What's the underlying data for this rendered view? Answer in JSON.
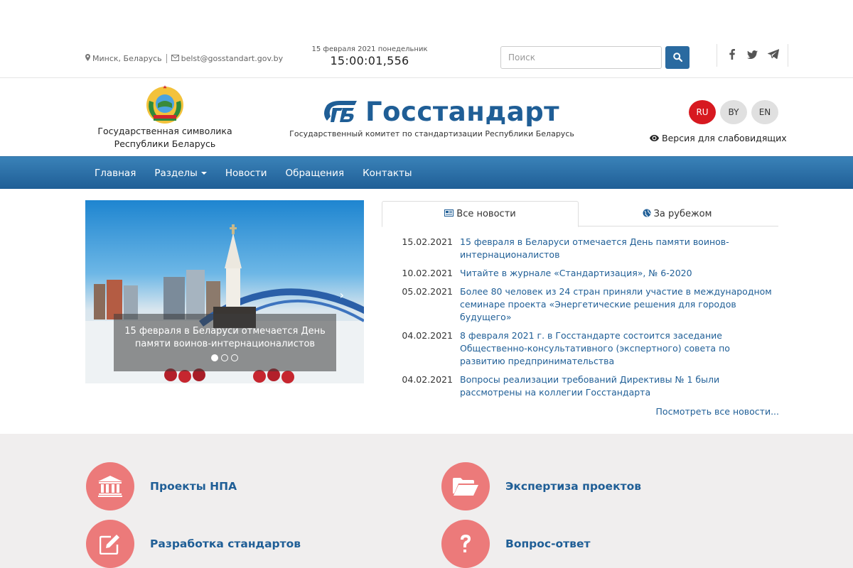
{
  "topbar": {
    "location": "Минск, Беларусь",
    "email": "belst@gosstandart.gov.by",
    "date": "15 февраля 2021 понедельник",
    "time": "15:00:01,556",
    "search_placeholder": "Поиск",
    "social_icons": [
      "facebook-icon",
      "twitter-icon",
      "telegram-icon"
    ]
  },
  "header": {
    "emblem_caption_line1": "Государственная символика",
    "emblem_caption_line2": "Республики Беларусь",
    "logo_text": "Госстандарт",
    "subtitle": "Государственный комитет по стандартизации Республики Беларусь",
    "languages": [
      {
        "code": "RU",
        "active": true
      },
      {
        "code": "BY",
        "active": false
      },
      {
        "code": "EN",
        "active": false
      }
    ],
    "low_vision_label": "Версия для слабовидящих",
    "brand_color": "#1f5e96",
    "accent_color": "#d71920"
  },
  "nav": {
    "items": [
      {
        "label": "Главная"
      },
      {
        "label": "Разделы",
        "dropdown": true
      },
      {
        "label": "Новости"
      },
      {
        "label": "Обращения"
      },
      {
        "label": "Контакты"
      }
    ]
  },
  "slider": {
    "caption": "15 февраля в Беларуси отмечается День памяти воинов-интернационалистов",
    "slide_count": 3,
    "active_slide": 1
  },
  "news": {
    "tabs": [
      {
        "label": "Все новости",
        "active": true
      },
      {
        "label": "За рубежом",
        "active": false
      }
    ],
    "items": [
      {
        "date": "15.02.2021",
        "title": "15 февраля в Беларуси отмечается День памяти воинов-интернационалистов"
      },
      {
        "date": "10.02.2021",
        "title": "Читайте в журнале «Стандартизация», № 6-2020"
      },
      {
        "date": "05.02.2021",
        "title": "Более 80 человек из 24 стран приняли участие в международном семинаре проекта «Энергетические решения для городов будущего»"
      },
      {
        "date": "04.02.2021",
        "title": "8 февраля 2021 г. в Госстандарте состоится заседание Общественно-консультативного (экспертного) совета по развитию предпринимательства"
      },
      {
        "date": "04.02.2021",
        "title": "Вопросы реализации требований Директивы № 1 были рассмотрены на коллегии Госстандарта"
      }
    ],
    "all_news_link": "Посмотреть все новости..."
  },
  "services": {
    "items": [
      {
        "label": "Проекты НПА",
        "icon": "institution-icon"
      },
      {
        "label": "Экспертиза проектов",
        "icon": "folder-open-icon"
      },
      {
        "label": "Разработка стандартов",
        "icon": "edit-icon"
      },
      {
        "label": "Вопрос-ответ",
        "icon": "question-icon"
      }
    ],
    "circle_color": "#ec7a7a"
  }
}
